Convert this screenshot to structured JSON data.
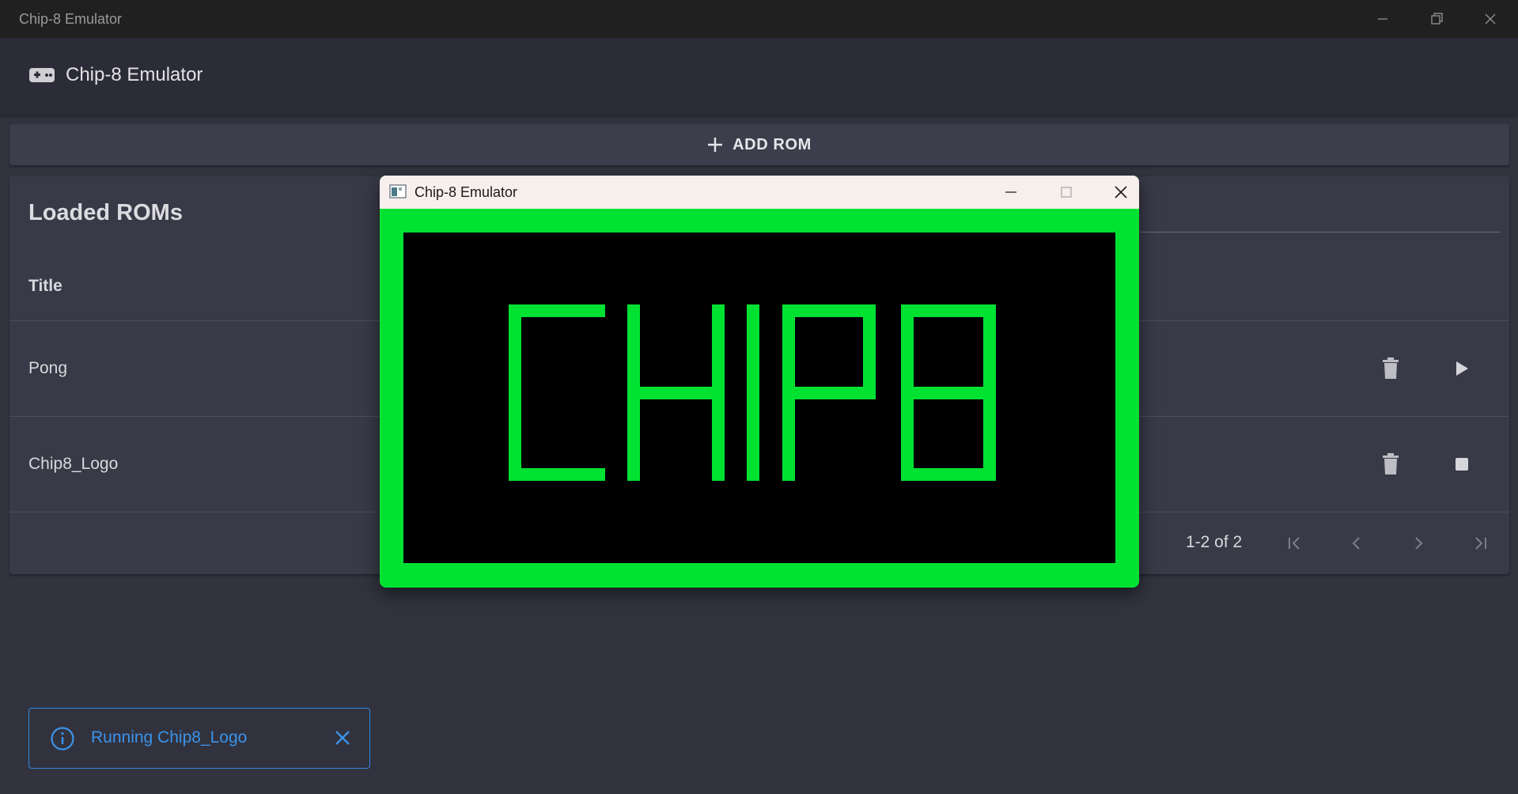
{
  "window": {
    "title": "Chip-8 Emulator"
  },
  "appbar": {
    "title": "Chip-8 Emulator",
    "icon": "gamepad-icon"
  },
  "actions": {
    "add_rom_label": "ADD ROM"
  },
  "roms_card": {
    "title": "Loaded ROMs",
    "column_title": "Title",
    "rows": [
      {
        "title": "Pong",
        "delete_icon": "trash-icon",
        "action_icon": "play-icon"
      },
      {
        "title": "Chip8_Logo",
        "delete_icon": "trash-icon",
        "action_icon": "stop-icon"
      }
    ],
    "pagination": {
      "range": "1-2 of 2"
    }
  },
  "emulator_window": {
    "title": "Chip-8 Emulator",
    "screen_text": "CHIP8",
    "colors": {
      "foreground": "#00e232",
      "background": "#000000"
    }
  },
  "toast": {
    "message": "Running Chip8_Logo",
    "icon": "info-icon"
  },
  "colors": {
    "accent": "#2f88e0",
    "background": "#32333f",
    "surface": "#393a48"
  }
}
